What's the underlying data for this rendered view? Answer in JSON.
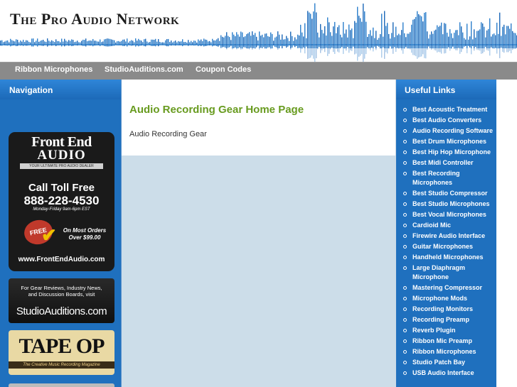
{
  "header": {
    "site_title": "The Pro Audio Network"
  },
  "topnav": {
    "links": [
      "Ribbon Microphones",
      "StudioAuditions.com",
      "Coupon Codes"
    ]
  },
  "left_sidebar": {
    "title": "Navigation",
    "banners": {
      "frontend": {
        "brand_line1": "Front End",
        "brand_line2": "AUDIO",
        "tagline": "YOUR ULTIMATE PRO AUDIO DEALER",
        "call": "Call Toll Free",
        "phone": "888-228-4530",
        "hours": "Monday-Friday 9am-6pm EST",
        "free_badge": "FREE",
        "orders_line1": "On Most Orders",
        "orders_line2": "Over $99.00",
        "url": "www.FrontEndAudio.com"
      },
      "studioauditions": {
        "line1": "For Gear Reviews, Industry News,",
        "line2": "and Discussion Boards, visit",
        "logo": "StudioAuditions.com"
      },
      "tapeop": {
        "logo": "TAPE OP",
        "strip": "The Creative Music Recording Magazine"
      }
    }
  },
  "main": {
    "heading": "Audio Recording Gear Home Page",
    "body": "Audio Recording Gear"
  },
  "right_sidebar": {
    "title": "Useful Links",
    "links": [
      "Best Acoustic Treatment",
      "Best Audio Converters",
      "Audio Recording Software",
      "Best Drum Microphones",
      "Best Hip Hop Microphone",
      "Best Midi Controller",
      "Best Recording Microphones",
      "Best Studio Compressor",
      "Best Studio Microphones",
      "Best Vocal Microphones",
      "Cardioid Mic",
      "Firewire Audio Interface",
      "Guitar Microphones",
      "Handheld Microphones",
      "Large Diaphragm Microphone",
      "Mastering Compressor",
      "Microphone Mods",
      "Recording Monitors",
      "Recording Preamp",
      "Reverb Plugin",
      "Ribbon Mic Preamp",
      "Ribbon Microphones",
      "Studio Patch Bay",
      "USB Audio Interface"
    ]
  },
  "colors": {
    "nav_blue": "#1f70be",
    "heading_green": "#689b1f",
    "topnav_gray": "#8a8a8a",
    "content_bg": "#ccdde9"
  }
}
